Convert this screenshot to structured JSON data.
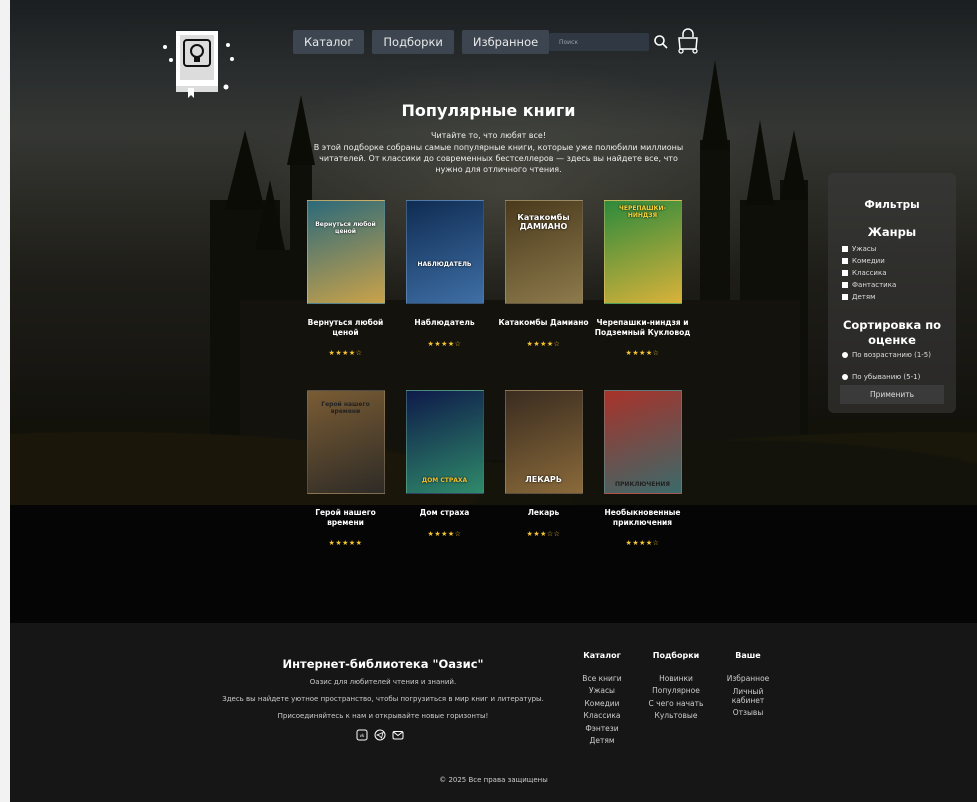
{
  "header": {
    "nav": [
      "Каталог",
      "Подборки",
      "Избранное"
    ],
    "search_placeholder": "Поиск"
  },
  "hero": {
    "title": "Популярные книги",
    "lead": "Читайте то, что любят все!",
    "text": "В этой подборке собраны самые популярные книги, которые уже полюбили миллионы читателей. От классики до современных бестселлеров — здесь вы найдете все, что нужно для отличного чтения."
  },
  "books": [
    {
      "title": "Вернуться любой ценой",
      "rating": "★★★★☆",
      "cover_text": "Вернуться любой ценой",
      "c1": "#2c6a7a",
      "c2": "#caa24a"
    },
    {
      "title": "Наблюдатель",
      "rating": "★★★★☆",
      "cover_text": "НАБЛЮДАТЕЛЬ",
      "c1": "#0f2c52",
      "c2": "#3f6fa6"
    },
    {
      "title": "Катакомбы Дамиано",
      "rating": "★★★★☆",
      "cover_text": "Катакомбы ДАМИАНО",
      "c1": "#4a3a1c",
      "c2": "#8d7a4c"
    },
    {
      "title": "Черепашки-ниндзя и Подземный Кукловод",
      "rating": "★★★★☆",
      "cover_text": "ЧЕРЕПАШКИ-НИНДЗЯ",
      "c1": "#2d8a3c",
      "c2": "#d9b23a"
    },
    {
      "title": "Герой нашего времени",
      "rating": "★★★★★",
      "cover_text": "Герой нашего времени",
      "c1": "#7a5c34",
      "c2": "#2e2b26"
    },
    {
      "title": "Дом страха",
      "rating": "★★★★☆",
      "cover_text": "ДОМ СТРАХА",
      "c1": "#0e1a4a",
      "c2": "#2f8a6a"
    },
    {
      "title": "Лекарь",
      "rating": "★★★☆☆",
      "cover_text": "ЛЕКАРЬ",
      "c1": "#3a2c20",
      "c2": "#8a6a3a"
    },
    {
      "title": "Необыкновенные приключения",
      "rating": "★★★★☆",
      "cover_text": "ПРИКЛЮЧЕНИЯ",
      "c1": "#a8322a",
      "c2": "#3a6a6a"
    }
  ],
  "filters": {
    "title": "Фильтры",
    "genres_title": "Жанры",
    "genres": [
      "Ужасы",
      "Комедии",
      "Классика",
      "Фантастика",
      "Детям"
    ],
    "sort_title": "Сортировка по оценке",
    "sort_options": [
      "По возрастанию (1-5)",
      "По убыванию (5-1)"
    ],
    "apply": "Применить"
  },
  "footer": {
    "brand": "Интернет-библиотека \"Оазис\"",
    "lines": [
      "Оазис для любителей чтения и знаний.",
      "Здесь вы найдете уютное пространство, чтобы погрузиться в мир книг и литературы.",
      "Присоединяйтесь к нам и открывайте новые горизонты!"
    ],
    "columns": [
      {
        "heading": "Каталог",
        "items": [
          "Все книги",
          "Ужасы",
          "Комедии",
          "Классика",
          "Фэнтези",
          "Детям"
        ]
      },
      {
        "heading": "Подборки",
        "items": [
          "Новинки",
          "Популярное",
          "С чего начать",
          "Культовые"
        ]
      },
      {
        "heading": "Ваше",
        "items": [
          "Избранное",
          "Личный кабинет",
          "Отзывы"
        ]
      }
    ],
    "copyright": "© 2025 Все права защищены",
    "social_icons": [
      "vk-icon",
      "telegram-icon",
      "mail-icon"
    ]
  },
  "colors": {
    "star": "#f4c430",
    "nav_bg": "#3d4650",
    "footer_bg": "#161616"
  }
}
